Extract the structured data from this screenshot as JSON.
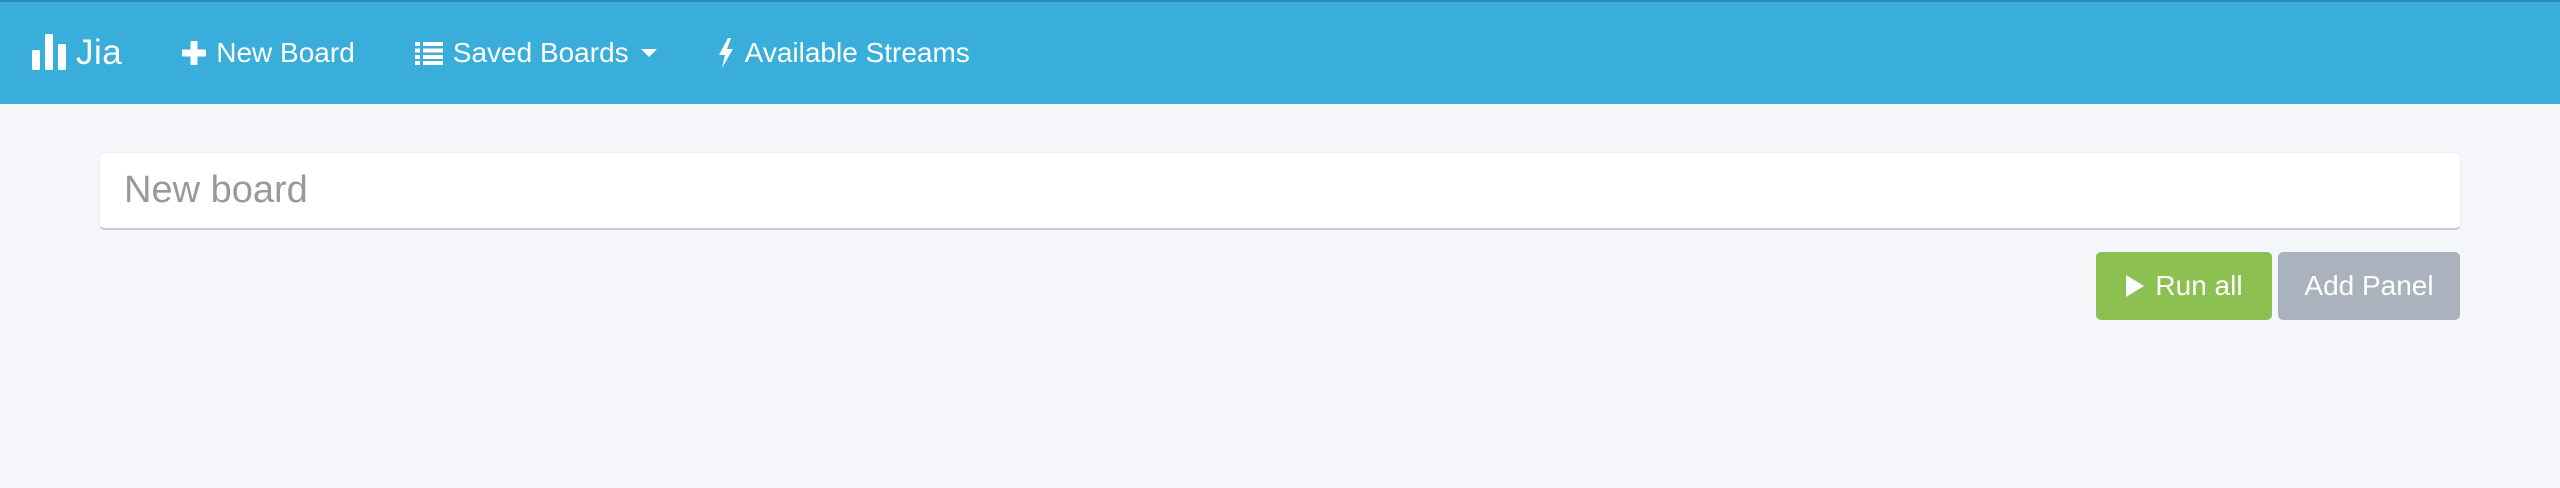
{
  "navbar": {
    "brand": "Jia",
    "new_board": "New Board",
    "saved_boards": "Saved Boards",
    "available_streams": "Available Streams",
    "icons": {
      "brand": "bar-chart-icon",
      "new_board": "plus-icon",
      "saved_boards": "list-icon",
      "saved_boards_caret": "caret-down-icon",
      "available_streams": "bolt-icon"
    },
    "background": "#3aaeda"
  },
  "board": {
    "title_value": "",
    "title_placeholder": "New board"
  },
  "actions": {
    "run_all": "Run all",
    "add_panel": "Add Panel",
    "run_all_icon": "play-icon",
    "run_all_color": "#8cc152",
    "add_panel_color": "#aab2bd"
  }
}
